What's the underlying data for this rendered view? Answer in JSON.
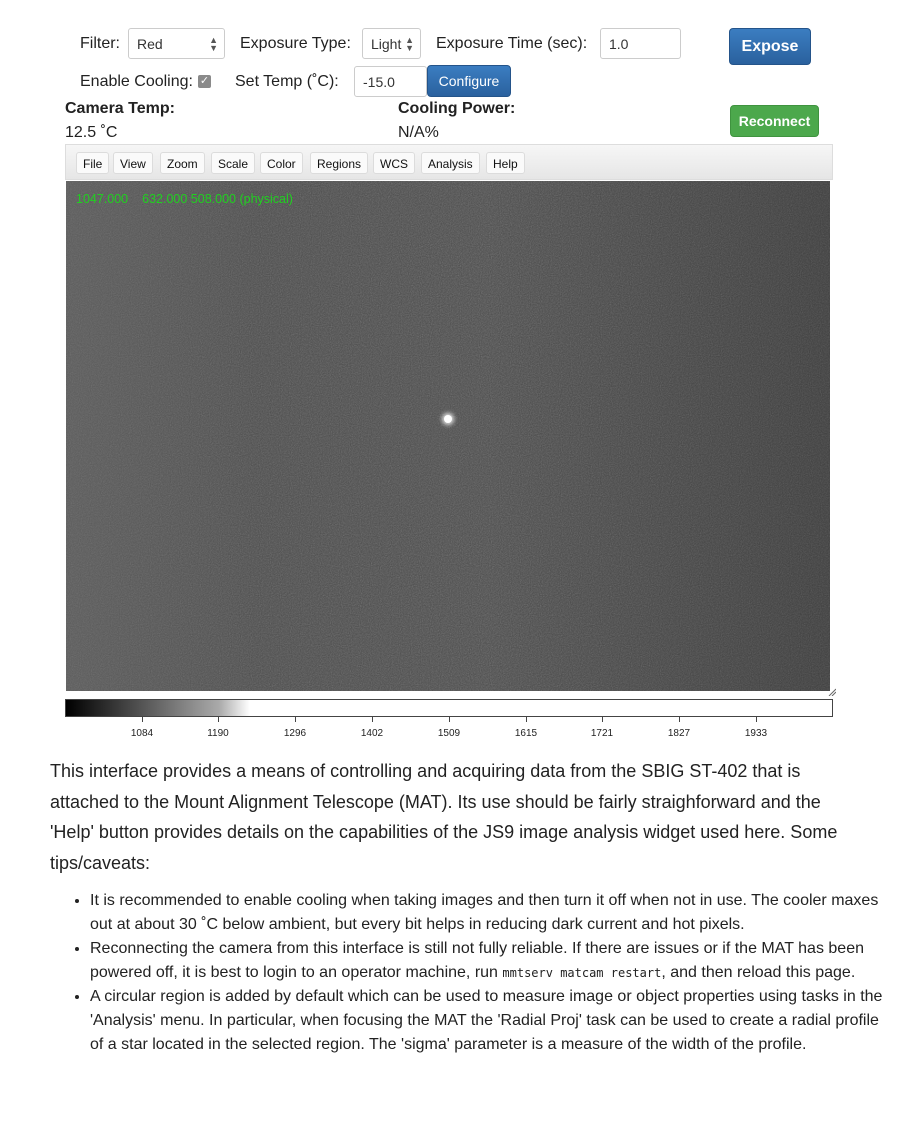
{
  "controls": {
    "filter_label": "Filter:",
    "filter_value": "Red",
    "exposure_type_label": "Exposure Type:",
    "exposure_type_value": "Light",
    "exposure_time_label": "Exposure Time (sec):",
    "exposure_time_value": "1.0",
    "expose_button": "Expose",
    "enable_cooling_label": "Enable Cooling:",
    "enable_cooling_checked": true,
    "set_temp_label": "Set Temp (˚C):",
    "set_temp_value": "-15.0",
    "configure_button": "Configure",
    "reconnect_button": "Reconnect"
  },
  "status": {
    "camera_temp_label": "Camera Temp:",
    "camera_temp_value": "12.5 ˚C",
    "cooling_power_label": "Cooling Power:",
    "cooling_power_value": "N/A%"
  },
  "js9": {
    "menu": [
      "File",
      "View",
      "Zoom",
      "Scale",
      "Color",
      "Regions",
      "WCS",
      "Analysis",
      "Help"
    ],
    "coords": {
      "value": "1047.000",
      "position": "632.000 508.000 (physical)"
    },
    "colorbar_ticks": [
      "1084",
      "1190",
      "1296",
      "1402",
      "1509",
      "1615",
      "1721",
      "1827",
      "1933"
    ]
  },
  "intro_text": "This interface provides a means of controlling and acquiring data from the SBIG ST-402 that is attached to the Mount Alignment Telescope (MAT). Its use should be fairly straighforward and the 'Help' button provides details on the capabilities of the JS9 image analysis widget used here. Some tips/caveats:",
  "tips": [
    {
      "text": "It is recommended to enable cooling when taking images and then turn it off when not in use. The cooler maxes out at about 30 ˚C below ambient, but every bit helps in reducing dark current and hot pixels."
    },
    {
      "pre": "Reconnecting the camera from this interface is still not fully reliable. If there are issues or if the MAT has been powered off, it is best to login to an operator machine, run ",
      "code": "mmtserv matcam restart",
      "post": ", and then reload this page."
    },
    {
      "text": "A circular region is added by default which can be used to measure image or object properties using tasks in the 'Analysis' menu. In particular, when focusing the MAT the 'Radial Proj' task can be used to create a radial profile of a star located in the selected region. The 'sigma' parameter is a measure of the width of the profile."
    }
  ]
}
